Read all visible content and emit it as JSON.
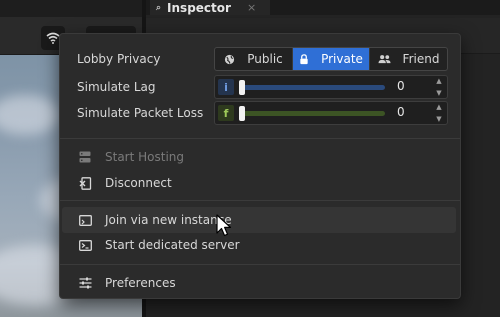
{
  "inspector": {
    "tab_label": "Inspector",
    "tab_close": "×",
    "tab_icon": "inspector-search-icon"
  },
  "toolbar": {
    "network_icon": "wifi-icon"
  },
  "popup": {
    "lobby_privacy": {
      "label": "Lobby Privacy",
      "options": [
        {
          "label": "Public",
          "icon": "globe-icon"
        },
        {
          "label": "Private",
          "icon": "lock-icon"
        },
        {
          "label": "Friend",
          "icon": "people-icon"
        }
      ],
      "selected": "Private",
      "selected_color": "#2f6fd6"
    },
    "simulate_lag": {
      "label": "Simulate Lag",
      "tag": "i",
      "value": "0",
      "accent": "#3a6fc4"
    },
    "simulate_packet_loss": {
      "label": "Simulate Packet Loss",
      "tag": "f",
      "value": "0",
      "accent": "#7aa53a"
    },
    "items": [
      {
        "label": "Start Hosting",
        "icon": "server-icon",
        "enabled": false
      },
      {
        "label": "Disconnect",
        "icon": "disconnect-icon",
        "enabled": true
      },
      {
        "label": "Join via new instance",
        "icon": "window-icon",
        "enabled": true,
        "hovered": true
      },
      {
        "label": "Start dedicated server",
        "icon": "terminal-icon",
        "enabled": true
      },
      {
        "label": "Preferences",
        "icon": "sliders-icon",
        "enabled": true
      }
    ]
  }
}
